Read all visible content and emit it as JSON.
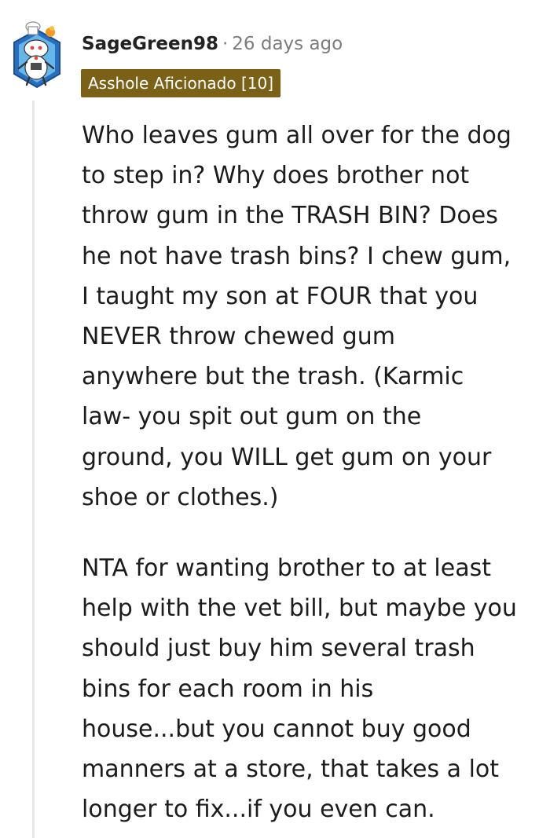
{
  "comment": {
    "username": "SageGreen98",
    "separator": "·",
    "timestamp": "26 days ago",
    "flair": "Asshole Aficionado [10]",
    "avatar_icon": "snoo-avatar-icon",
    "paragraphs": [
      "Who leaves gum all over for the dog\nto step in? Why does brother not\nthrow gum in the TRASH BIN? Does\nhe not have trash bins? I chew gum,\nI taught my son at FOUR that you\nNEVER throw chewed gum\nanywhere but the trash. (Karmic\nlaw- you spit out gum on the\nground, you WILL get gum on your\nshoe or clothes.)",
      "NTA for wanting brother to at least\nhelp with the vet bill, but maybe you\nshould just buy him several trash\nbins for each room in his\nhouse...but you cannot buy good\nmanners at a store, that takes a lot\nlonger to fix...if you even can."
    ]
  },
  "colors": {
    "flair_background": "#7b6118",
    "flair_text": "#ffffff",
    "body_text": "#1c1c1c",
    "meta_text": "#7c7c7c",
    "thread_line": "#e8e8e8"
  }
}
